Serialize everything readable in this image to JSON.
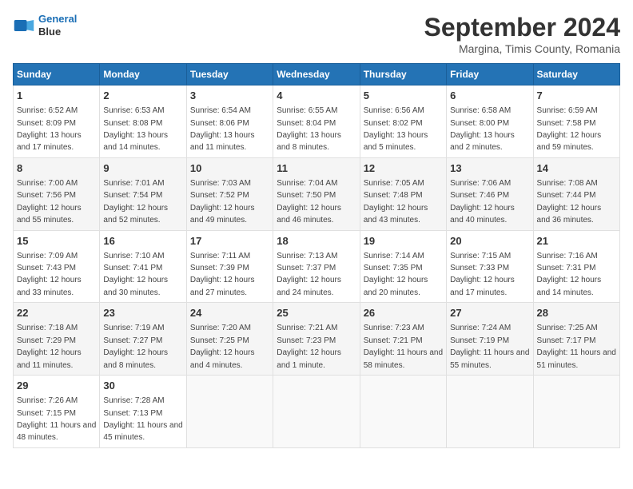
{
  "header": {
    "logo_line1": "General",
    "logo_line2": "Blue",
    "title": "September 2024",
    "subtitle": "Margina, Timis County, Romania"
  },
  "columns": [
    "Sunday",
    "Monday",
    "Tuesday",
    "Wednesday",
    "Thursday",
    "Friday",
    "Saturday"
  ],
  "weeks": [
    [
      {
        "day": 1,
        "info": "Sunrise: 6:52 AM\nSunset: 8:09 PM\nDaylight: 13 hours and 17 minutes."
      },
      {
        "day": 2,
        "info": "Sunrise: 6:53 AM\nSunset: 8:08 PM\nDaylight: 13 hours and 14 minutes."
      },
      {
        "day": 3,
        "info": "Sunrise: 6:54 AM\nSunset: 8:06 PM\nDaylight: 13 hours and 11 minutes."
      },
      {
        "day": 4,
        "info": "Sunrise: 6:55 AM\nSunset: 8:04 PM\nDaylight: 13 hours and 8 minutes."
      },
      {
        "day": 5,
        "info": "Sunrise: 6:56 AM\nSunset: 8:02 PM\nDaylight: 13 hours and 5 minutes."
      },
      {
        "day": 6,
        "info": "Sunrise: 6:58 AM\nSunset: 8:00 PM\nDaylight: 13 hours and 2 minutes."
      },
      {
        "day": 7,
        "info": "Sunrise: 6:59 AM\nSunset: 7:58 PM\nDaylight: 12 hours and 59 minutes."
      }
    ],
    [
      {
        "day": 8,
        "info": "Sunrise: 7:00 AM\nSunset: 7:56 PM\nDaylight: 12 hours and 55 minutes."
      },
      {
        "day": 9,
        "info": "Sunrise: 7:01 AM\nSunset: 7:54 PM\nDaylight: 12 hours and 52 minutes."
      },
      {
        "day": 10,
        "info": "Sunrise: 7:03 AM\nSunset: 7:52 PM\nDaylight: 12 hours and 49 minutes."
      },
      {
        "day": 11,
        "info": "Sunrise: 7:04 AM\nSunset: 7:50 PM\nDaylight: 12 hours and 46 minutes."
      },
      {
        "day": 12,
        "info": "Sunrise: 7:05 AM\nSunset: 7:48 PM\nDaylight: 12 hours and 43 minutes."
      },
      {
        "day": 13,
        "info": "Sunrise: 7:06 AM\nSunset: 7:46 PM\nDaylight: 12 hours and 40 minutes."
      },
      {
        "day": 14,
        "info": "Sunrise: 7:08 AM\nSunset: 7:44 PM\nDaylight: 12 hours and 36 minutes."
      }
    ],
    [
      {
        "day": 15,
        "info": "Sunrise: 7:09 AM\nSunset: 7:43 PM\nDaylight: 12 hours and 33 minutes."
      },
      {
        "day": 16,
        "info": "Sunrise: 7:10 AM\nSunset: 7:41 PM\nDaylight: 12 hours and 30 minutes."
      },
      {
        "day": 17,
        "info": "Sunrise: 7:11 AM\nSunset: 7:39 PM\nDaylight: 12 hours and 27 minutes."
      },
      {
        "day": 18,
        "info": "Sunrise: 7:13 AM\nSunset: 7:37 PM\nDaylight: 12 hours and 24 minutes."
      },
      {
        "day": 19,
        "info": "Sunrise: 7:14 AM\nSunset: 7:35 PM\nDaylight: 12 hours and 20 minutes."
      },
      {
        "day": 20,
        "info": "Sunrise: 7:15 AM\nSunset: 7:33 PM\nDaylight: 12 hours and 17 minutes."
      },
      {
        "day": 21,
        "info": "Sunrise: 7:16 AM\nSunset: 7:31 PM\nDaylight: 12 hours and 14 minutes."
      }
    ],
    [
      {
        "day": 22,
        "info": "Sunrise: 7:18 AM\nSunset: 7:29 PM\nDaylight: 12 hours and 11 minutes."
      },
      {
        "day": 23,
        "info": "Sunrise: 7:19 AM\nSunset: 7:27 PM\nDaylight: 12 hours and 8 minutes."
      },
      {
        "day": 24,
        "info": "Sunrise: 7:20 AM\nSunset: 7:25 PM\nDaylight: 12 hours and 4 minutes."
      },
      {
        "day": 25,
        "info": "Sunrise: 7:21 AM\nSunset: 7:23 PM\nDaylight: 12 hours and 1 minute."
      },
      {
        "day": 26,
        "info": "Sunrise: 7:23 AM\nSunset: 7:21 PM\nDaylight: 11 hours and 58 minutes."
      },
      {
        "day": 27,
        "info": "Sunrise: 7:24 AM\nSunset: 7:19 PM\nDaylight: 11 hours and 55 minutes."
      },
      {
        "day": 28,
        "info": "Sunrise: 7:25 AM\nSunset: 7:17 PM\nDaylight: 11 hours and 51 minutes."
      }
    ],
    [
      {
        "day": 29,
        "info": "Sunrise: 7:26 AM\nSunset: 7:15 PM\nDaylight: 11 hours and 48 minutes."
      },
      {
        "day": 30,
        "info": "Sunrise: 7:28 AM\nSunset: 7:13 PM\nDaylight: 11 hours and 45 minutes."
      },
      null,
      null,
      null,
      null,
      null
    ]
  ]
}
